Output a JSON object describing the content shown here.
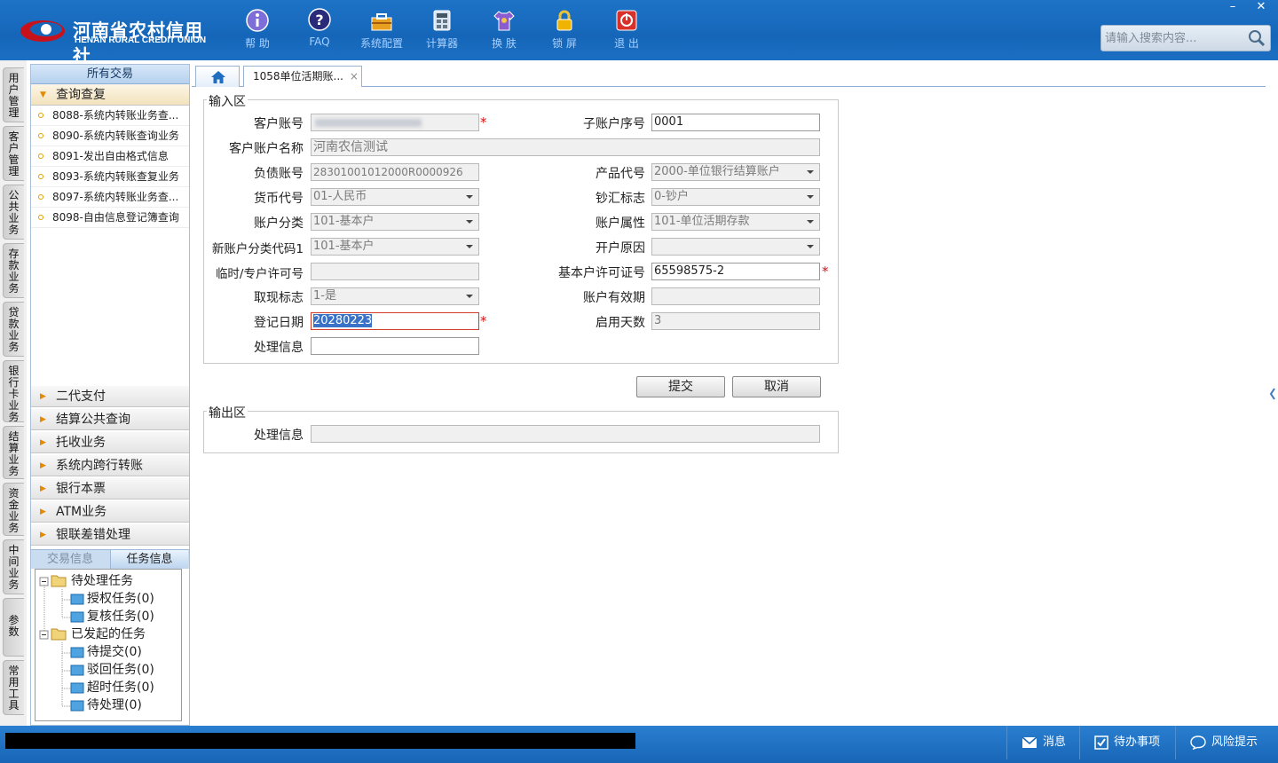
{
  "header": {
    "logo_cn": "河南省农村信用社",
    "logo_en": "HENAN RURAL CREDIT UNION",
    "toolbar": [
      {
        "label": "帮 助",
        "icon": "info-icon"
      },
      {
        "label": "FAQ",
        "icon": "help-icon"
      },
      {
        "label": "系统配置",
        "icon": "toolbox-icon"
      },
      {
        "label": "计算器",
        "icon": "calculator-icon"
      },
      {
        "label": "换 肤",
        "icon": "shirt-icon"
      },
      {
        "label": "锁 屏",
        "icon": "lock-icon"
      },
      {
        "label": "退 出",
        "icon": "power-icon"
      }
    ],
    "minimize": "–",
    "close": "✕",
    "search_placeholder": "请输入搜索内容..."
  },
  "vtabs": [
    "用户管理",
    "客户管理",
    "公共业务",
    "存款业务",
    "贷款业务",
    "银行卡业务",
    "结算业务",
    "资金业务",
    "中间业务",
    "参数",
    "常用工具"
  ],
  "sidebar": {
    "header": "所有交易",
    "open_group": "查询查复",
    "items": [
      "8088-系统内转账业务查...",
      "8090-系统内转账查询业务",
      "8091-发出自由格式信息",
      "8093-系统内转账查复业务",
      "8097-系统内转账业务查...",
      "8098-自由信息登记簿查询"
    ],
    "groups": [
      "二代支付",
      "结算公共查询",
      "托收业务",
      "系统内跨行转账",
      "银行本票",
      "ATM业务",
      "银联差错处理"
    ],
    "subtabs": [
      "交易信息",
      "任务信息"
    ],
    "tree": {
      "pending": "待处理任务",
      "auth": "授权任务(0)",
      "review": "复核任务(0)",
      "initiated": "已发起的任务",
      "to_submit": "待提交(0)",
      "rejected": "驳回任务(0)",
      "timeout": "超时任务(0)",
      "to_process": "待处理(0)"
    }
  },
  "tabs": {
    "active": "1058单位活期账...",
    "close": "×"
  },
  "form": {
    "input_legend": "输入区",
    "output_legend": "输出区",
    "labels": {
      "cust_acct": "客户账号",
      "sub_acct": "子账户序号",
      "acct_name": "客户账户名称",
      "liab_acct": "负债账号",
      "product": "产品代号",
      "currency": "货币代号",
      "cash_flag": "钞汇标志",
      "acct_class": "账户分类",
      "acct_attr": "账户属性",
      "new_class": "新账户分类代码1",
      "open_reason": "开户原因",
      "temp_permit": "临时/专户许可号",
      "basic_permit": "基本户许可证号",
      "withdraw_flag": "取现标志",
      "valid_period": "账户有效期",
      "reg_date": "登记日期",
      "active_days": "启用天数",
      "proc_info": "处理信息",
      "out_proc_info": "处理信息"
    },
    "values": {
      "cust_acct": "",
      "sub_acct": "0001",
      "acct_name": "河南农信测试",
      "liab_acct": "28301001012000R0000926",
      "product": "2000-单位银行结算账户",
      "currency": "01-人民币",
      "cash_flag": "0-钞户",
      "acct_class": "101-基本户",
      "acct_attr": "101-单位活期存款",
      "new_class": "101-基本户",
      "open_reason": "",
      "temp_permit": "",
      "basic_permit": "65598575-2",
      "withdraw_flag": "1-是",
      "valid_period": "",
      "reg_date": "20280223",
      "active_days": "3",
      "proc_info": "",
      "out_proc_info": ""
    },
    "required": "*",
    "submit": "提交",
    "cancel": "取消"
  },
  "footer": {
    "message": "消息",
    "todo": "待办事项",
    "risk": "风险提示"
  }
}
